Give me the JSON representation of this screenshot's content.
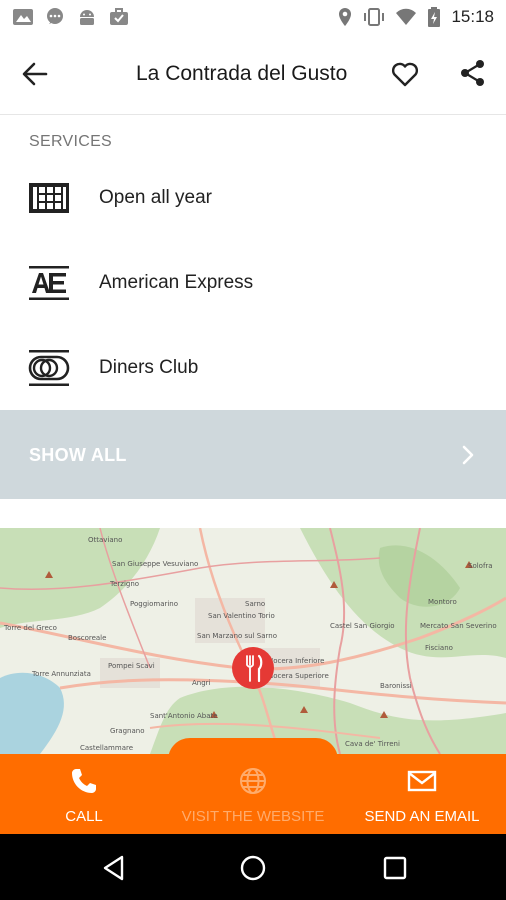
{
  "status_bar": {
    "time": "15:18",
    "icons": [
      "gallery-icon",
      "chat-icon",
      "android-icon",
      "briefcase-icon",
      "location-icon",
      "vibrate-icon",
      "wifi-icon",
      "battery-icon"
    ]
  },
  "app_bar": {
    "title": "La Contrada del Gusto",
    "icons": [
      "back-arrow-icon",
      "heart-icon",
      "share-icon"
    ]
  },
  "services": {
    "heading": "SERVICES",
    "items": [
      {
        "label": "Open all year",
        "icon": "calendar-grid-icon"
      },
      {
        "label": "American Express",
        "icon": "amex-icon"
      },
      {
        "label": "Diners Club",
        "icon": "diners-club-icon"
      }
    ],
    "show_all_label": "SHOW ALL"
  },
  "map": {
    "marker_icon": "restaurant-fork-knife-icon",
    "places": [
      "Ottaviano",
      "San Giuseppe Vesuviano",
      "Terzigno",
      "Poggiomarino",
      "Boscoreale",
      "Pompei Scavi",
      "Torre Annunziata",
      "Torre del Greco",
      "San Valentino Torio",
      "Sarno",
      "San Marzano sul Sarno",
      "Angri",
      "Nocera Inferiore",
      "Nocera Superiore",
      "Castel San Giorgio",
      "Mercato San Severino",
      "Fisciano",
      "Montoro",
      "Solofra",
      "Sant'Antonio Abate",
      "Gragnano",
      "Castellammare",
      "Cava de' Tirreni",
      "Baronissi"
    ]
  },
  "bottom_bar": {
    "call_label": "CALL",
    "website_label": "VISIT THE WEBSITE",
    "email_label": "SEND AN EMAIL"
  },
  "colors": {
    "accent": "#ff6d00",
    "marker": "#e53935",
    "show_all_bg": "#cfd8dc"
  }
}
